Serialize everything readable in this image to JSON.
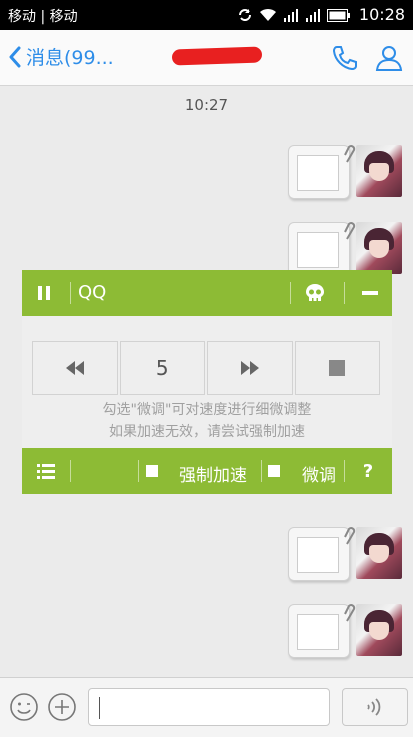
{
  "status_bar": {
    "carrier": "移动 | 移动",
    "time": "10:28"
  },
  "header": {
    "back_label": "消息(99..."
  },
  "chat": {
    "timestamp": "10:27"
  },
  "speed_panel": {
    "app_label": "QQ",
    "speed_value": "5",
    "tip_line1": "勾选\"微调\"可对速度进行细微调整",
    "tip_line2": "如果加速无效，请尝试强制加速",
    "force_speed_label": "强制加速",
    "fine_tune_label": "微调",
    "help_label": "?"
  },
  "colors": {
    "panel_green": "#8dbb35",
    "link_blue": "#2e8de8"
  }
}
